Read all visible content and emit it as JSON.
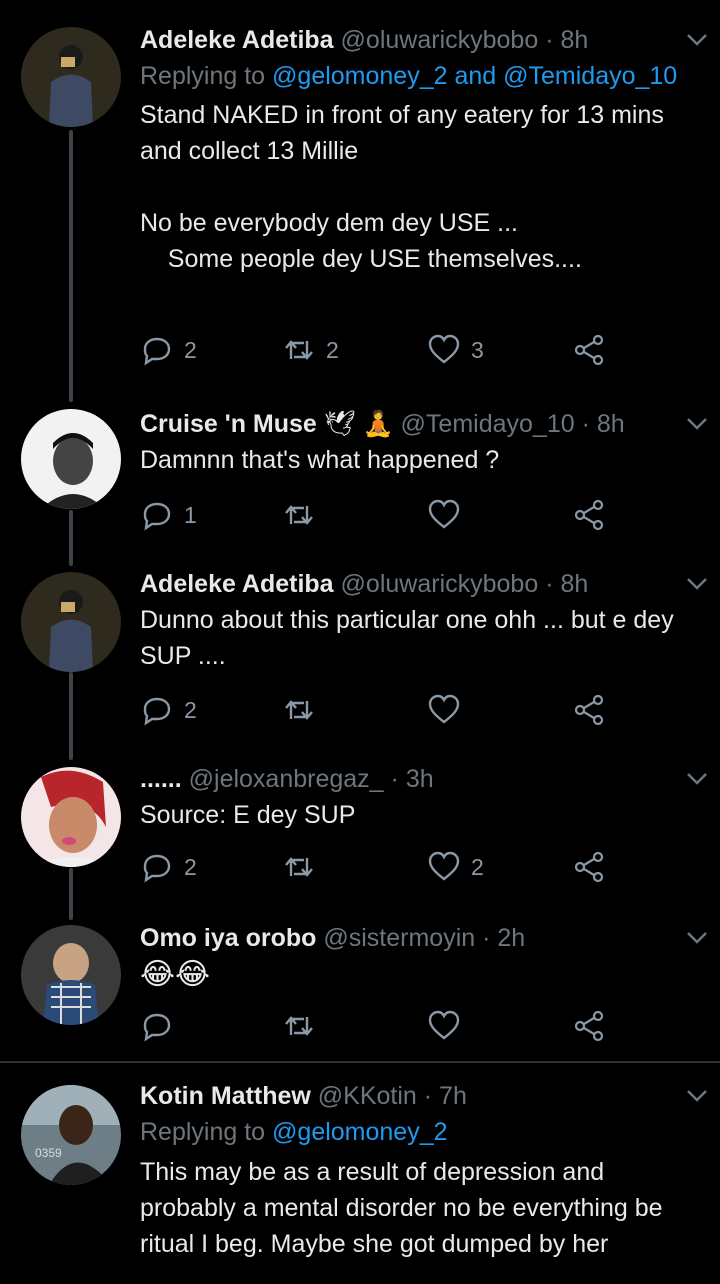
{
  "tweets": [
    {
      "name": "Adeleke Adetiba",
      "handle": "@oluwarickybobo",
      "time": "· 8h",
      "replying_prefix": "Replying to",
      "replying_users": "@gelomoney_2 and @Temidayo_10",
      "text": "Stand NAKED in front of any eatery for 13 mins and collect 13 Millie\n\nNo be everybody dem dey USE ...\n    Some people dey USE themselves....",
      "replies": "2",
      "retweets": "2",
      "likes": "3"
    },
    {
      "name": "Cruise 'n Muse",
      "name_emoji": "🕊 🧘",
      "handle": "@Temidayo_10",
      "time": "· 8h",
      "text": "Damnnn that's what happened ?",
      "replies": "1",
      "retweets": "",
      "likes": ""
    },
    {
      "name": "Adeleke Adetiba",
      "handle": "@oluwarickybobo",
      "time": "· 8h",
      "text": "Dunno about this particular one ohh ... but e dey SUP ....",
      "replies": "2",
      "retweets": "",
      "likes": ""
    },
    {
      "name": "......",
      "handle": "@jeloxanbregaz_",
      "time": "· 3h",
      "text": "Source: E dey SUP",
      "replies": "2",
      "retweets": "",
      "likes": "2"
    },
    {
      "name": "Omo iya orobo",
      "handle": "@sistermoyin",
      "time": "· 2h",
      "text": "😂😂",
      "replies": "",
      "retweets": "",
      "likes": ""
    },
    {
      "name": "Kotin Matthew",
      "handle": "@KKotin",
      "time": "· 7h",
      "replying_prefix": "Replying to",
      "replying_users": "@gelomoney_2",
      "text": "This may be as a result of depression and probably a mental disorder no be everything be ritual I beg. Maybe she got dumped by her"
    }
  ],
  "avatar_text": "0359",
  "colors": {
    "background": "#000000",
    "link": "#1d9bf0",
    "muted": "#6e767d",
    "thread": "#3d4348"
  }
}
